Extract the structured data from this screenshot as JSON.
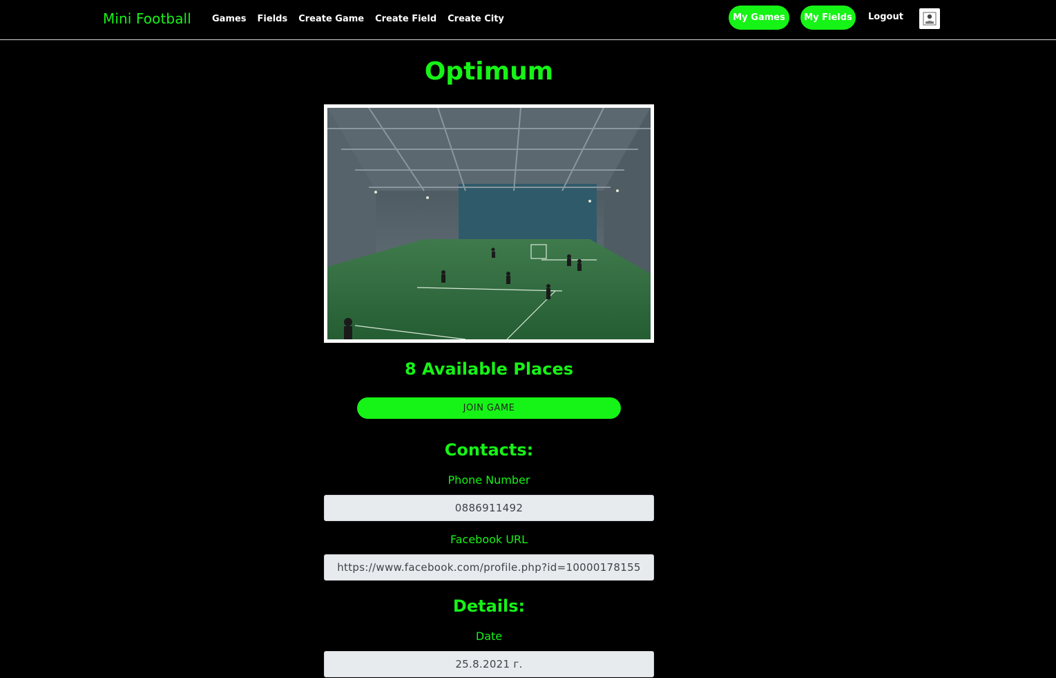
{
  "nav": {
    "brand": "Mini Football",
    "links": [
      "Games",
      "Fields",
      "Create Game",
      "Create Field",
      "Create City"
    ],
    "my_games": "My Games",
    "my_fields": "My Fields",
    "logout": "Logout",
    "accent_color": "#16f316"
  },
  "field": {
    "title": "Optimum",
    "image_icon": "indoor-football-pitch-photo",
    "available_places": "8 Available Places",
    "join_label": "JOIN GAME"
  },
  "contacts": {
    "heading": "Contacts:",
    "phone_label": "Phone Number",
    "phone_value": "0886911492",
    "facebook_label": "Facebook URL",
    "facebook_value": "https://www.facebook.com/profile.php?id=10000178155"
  },
  "details": {
    "heading": "Details:",
    "date_label": "Date",
    "date_value": "25.8.2021 г."
  }
}
